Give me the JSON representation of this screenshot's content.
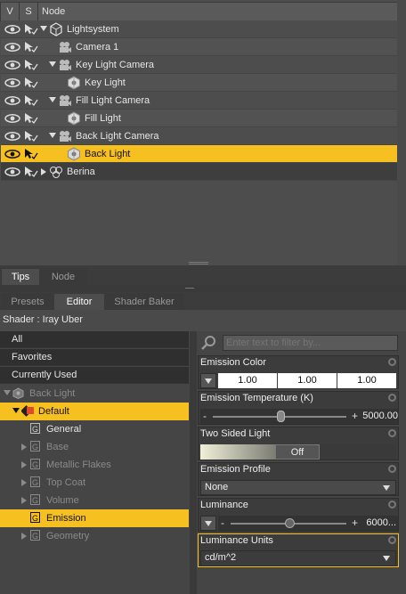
{
  "scene": {
    "columns": {
      "v": "V",
      "s": "S",
      "node": "Node"
    },
    "nodes": [
      {
        "label": "Lightsystem",
        "icon": "group-icon",
        "expanded": true
      },
      {
        "label": "Camera 1",
        "icon": "camera-icon"
      },
      {
        "label": "Key Light Camera",
        "icon": "camera-icon",
        "expanded": true
      },
      {
        "label": "Key Light",
        "icon": "light-icon"
      },
      {
        "label": "Fill Light Camera",
        "icon": "camera-icon",
        "expanded": true
      },
      {
        "label": "Fill Light",
        "icon": "light-icon"
      },
      {
        "label": "Back Light Camera",
        "icon": "camera-icon",
        "expanded": true
      },
      {
        "label": "Back Light",
        "icon": "light-icon",
        "selected": true
      },
      {
        "label": "Berina",
        "icon": "figure-icon",
        "expanded": false
      }
    ]
  },
  "pane_tabs": {
    "tips": "Tips",
    "node": "Node"
  },
  "surface_tabs": {
    "presets": "Presets",
    "editor": "Editor",
    "shader_baker": "Shader Baker"
  },
  "shader_label": "Shader : Iray Uber",
  "left_list": {
    "all": "All",
    "favorites": "Favorites",
    "currently_used": "Currently Used"
  },
  "surface_tree": {
    "root": "Back Light",
    "default": "Default",
    "groups": [
      {
        "label": "General",
        "dim": false,
        "expander": false
      },
      {
        "label": "Base",
        "dim": true,
        "expander": true
      },
      {
        "label": "Metallic Flakes",
        "dim": true,
        "expander": true
      },
      {
        "label": "Top Coat",
        "dim": true,
        "expander": true
      },
      {
        "label": "Volume",
        "dim": true,
        "expander": true
      },
      {
        "label": "Emission",
        "dim": false,
        "expander": false,
        "selected": true
      },
      {
        "label": "Geometry",
        "dim": true,
        "expander": true
      }
    ]
  },
  "filter": {
    "placeholder": "Enter text to filter by..."
  },
  "properties": {
    "emission_color": {
      "label": "Emission Color",
      "r": "1.00",
      "g": "1.00",
      "b": "1.00"
    },
    "emission_temperature": {
      "label": "Emission Temperature (K)",
      "value": "5000.00",
      "minus": "-",
      "plus": "+"
    },
    "two_sided_light": {
      "label": "Two Sided Light",
      "value": "Off"
    },
    "emission_profile": {
      "label": "Emission Profile",
      "value": "None"
    },
    "luminance": {
      "label": "Luminance",
      "value": "6000...",
      "minus": "-",
      "plus": "+"
    },
    "luminance_units": {
      "label": "Luminance Units",
      "value": "cd/m^2"
    }
  },
  "colors": {
    "accent": "#f5c020",
    "panel": "#4d4d4d",
    "dark": "#3c3c3c"
  }
}
